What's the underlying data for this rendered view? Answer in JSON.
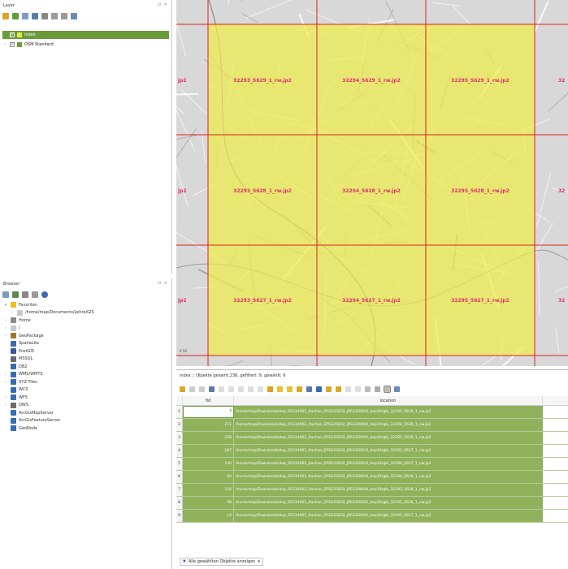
{
  "layers_panel": {
    "title": "Layer",
    "controls": "⊡ ✕",
    "layers": [
      {
        "label": "index",
        "checked": true,
        "selected": true,
        "swatch": "#e8e84a"
      },
      {
        "label": "OSM Standard",
        "checked": true,
        "selected": false,
        "swatch": "#6a9c3b"
      }
    ]
  },
  "browser_panel": {
    "title": "Browser",
    "controls": "⊡ ✕",
    "items": [
      {
        "label": "Favoriten",
        "expand": "▾",
        "indent": 0,
        "icon": "star-icon",
        "color": "#f0c020"
      },
      {
        "label": "/home/map/Documents/Lehre/GIS",
        "expand": "›",
        "indent": 1,
        "icon": "folder-icon",
        "color": "#c8c8c8"
      },
      {
        "label": "Home",
        "expand": "›",
        "indent": 0,
        "icon": "home-icon",
        "color": "#8a8a8a"
      },
      {
        "label": "/",
        "expand": "›",
        "indent": 0,
        "icon": "folder-icon",
        "color": "#c8c8c8"
      },
      {
        "label": "GeoPackage",
        "expand": "›",
        "indent": 0,
        "icon": "geopackage-icon",
        "color": "#9c7a2a"
      },
      {
        "label": "SpatiaLite",
        "expand": "",
        "indent": 0,
        "icon": "spatialite-icon",
        "color": "#3a6ab0"
      },
      {
        "label": "PostGIS",
        "expand": "",
        "indent": 0,
        "icon": "postgis-icon",
        "color": "#3a5a9c"
      },
      {
        "label": "MSSQL",
        "expand": "",
        "indent": 0,
        "icon": "mssql-icon",
        "color": "#6a6a6a"
      },
      {
        "label": "DB2",
        "expand": "",
        "indent": 0,
        "icon": "db2-icon",
        "color": "#3a6ab0"
      },
      {
        "label": "WMS/WMTS",
        "expand": "›",
        "indent": 0,
        "icon": "wms-icon",
        "color": "#3a6ab0"
      },
      {
        "label": "XYZ Tiles",
        "expand": "›",
        "indent": 0,
        "icon": "xyz-tiles-icon",
        "color": "#3a6ab0"
      },
      {
        "label": "WCS",
        "expand": "",
        "indent": 0,
        "icon": "wcs-icon",
        "color": "#3a6ab0"
      },
      {
        "label": "WFS",
        "expand": "›",
        "indent": 0,
        "icon": "wfs-icon",
        "color": "#3a6ab0"
      },
      {
        "label": "OWS",
        "expand": "›",
        "indent": 0,
        "icon": "ows-icon",
        "color": "#6a6a6a"
      },
      {
        "label": "ArcGisMapServer",
        "expand": "",
        "indent": 0,
        "icon": "arcgis-map-icon",
        "color": "#3a6ab0"
      },
      {
        "label": "ArcGisFeatureServer",
        "expand": "",
        "indent": 0,
        "icon": "arcgis-feature-icon",
        "color": "#3a6ab0"
      },
      {
        "label": "GeoNode",
        "expand": "",
        "indent": 0,
        "icon": "geonode-icon",
        "color": "#3a6ab0"
      }
    ]
  },
  "map": {
    "tile_labels": [
      [
        "32293_5629_1_rw.jp2",
        "32294_5629_1_rw.jp2",
        "32295_5629_1_rw.jp2"
      ],
      [
        "32293_5628_1_rw.jp2",
        "32294_5628_1_rw.jp2",
        "32295_5628_1_rw.jp2"
      ],
      [
        "32293_5627_1_rw.jp2",
        "32294_5627_1_rw.jp2",
        "32295_5627_1_rw.jp2"
      ]
    ],
    "edge_label_left": "jp2",
    "edge_label_right": "32",
    "scale_text": "0 50",
    "colors": {
      "fill": "#eded4a",
      "grid": "#e02020",
      "label": "#e0306a",
      "basemap": "#d8d8d8"
    }
  },
  "attribute_table": {
    "title": "index :: Objekte gesamt:236, gefiltert: 9, gewählt: 9",
    "columns": [
      "fid",
      "location"
    ],
    "rows": [
      {
        "num": "1",
        "fid": "7",
        "location": "/home/map/Downloads/dop_05334002_Aachen_EPSG25832_JPEG2000/3_dop10rgbi_32293_5629_1_nw.jp2"
      },
      {
        "num": "2",
        "fid": "211",
        "location": "/home/map/Downloads/dop_05334002_Aachen_EPSG25832_JPEG2000/4_dop10rgbi_32294_5629_1_nw.jp2"
      },
      {
        "num": "3",
        "fid": "220",
        "location": "/home/map/Downloads/dop_05334002_Aachen_EPSG25832_JPEG2000/5_dop10rgbi_32295_5629_1_nw.jp2"
      },
      {
        "num": "4",
        "fid": "187",
        "location": "/home/map/Downloads/dop_05334002_Aachen_EPSG25832_JPEG2000/3_dop10rgbi_32293_5627_1_nw.jp2"
      },
      {
        "num": "5",
        "fid": "130",
        "location": "/home/map/Downloads/dop_05334002_Aachen_EPSG25832_JPEG2000/4_dop10rgbi_32294_5627_1_nw.jp2"
      },
      {
        "num": "6",
        "fid": "82",
        "location": "/home/map/Downloads/dop_05334002_Aachen_EPSG25832_JPEG2000/4_dop10rgbi_32294_5628_1_nw.jp2"
      },
      {
        "num": "7",
        "fid": "116",
        "location": "/home/map/Downloads/dop_05334002_Aachen_EPSG25832_JPEG2000/4_dop10rgbi_32293_5628_1_nw.jp2"
      },
      {
        "num": "8",
        "fid": "99",
        "location": "/home/map/Downloads/dop_05334002_Aachen_EPSG25832_JPEG2000/5_dop10rgbi_32295_5628_1_nw.jp2"
      },
      {
        "num": "9",
        "fid": "14",
        "location": "/home/map/Downloads/dop_05334002_Aachen_EPSG25832_JPEG2000/5_dop10rgbi_32295_5627_1_nw.jp2"
      }
    ],
    "footer_button": "Alle gewählten Objekte anzeigen",
    "footer_arrow": "▾"
  }
}
